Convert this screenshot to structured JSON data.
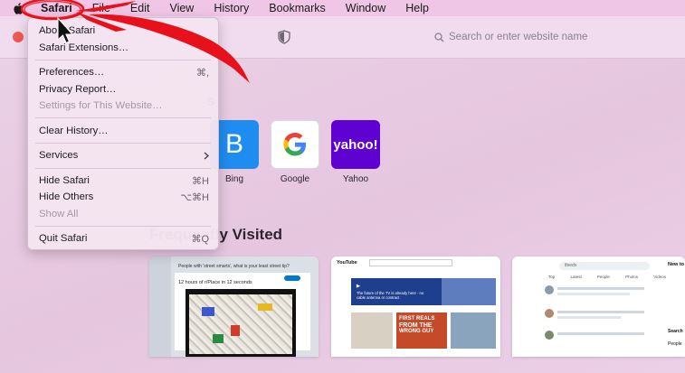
{
  "menubar": {
    "items": [
      "Safari",
      "File",
      "Edit",
      "View",
      "History",
      "Bookmarks",
      "Window",
      "Help"
    ]
  },
  "toolbar": {
    "address_placeholder": "Search or enter website name"
  },
  "favorites": {
    "partial_heading": "s",
    "items": [
      {
        "label": "Bing",
        "glyph": "B",
        "color": "#1f8cf0"
      },
      {
        "label": "Google",
        "glyph": "G",
        "color": "#ffffff"
      },
      {
        "label": "Yahoo",
        "glyph": "yahoo!",
        "color": "#5f01d1"
      }
    ]
  },
  "frequently_visited": {
    "title": "Frequently Visited",
    "thumb1": {
      "header": "People with 'street smarts', what is your least street tip?",
      "subtitle": "12 hours of r/Place in 12 seconds"
    },
    "thumb2": {
      "brand": "YouTube",
      "headline": "The future of the TV is already here - no cable antenna or contract",
      "thumb_text_1": "FIRST REALS",
      "thumb_text_2": "FROM THE",
      "thumb_text_3": "WRONG GUY"
    },
    "thumb3": {
      "search": "ifeeds",
      "tabs": [
        "Top",
        "Latest",
        "People",
        "Photos",
        "Videos"
      ],
      "side_title": "New to",
      "side_label_2": "Search",
      "side_label_3": "People"
    }
  },
  "safari_menu": {
    "about": "About Safari",
    "extensions": "Safari Extensions…",
    "preferences": "Preferences…",
    "preferences_shortcut": "⌘,",
    "privacy": "Privacy Report…",
    "settings_site": "Settings for This Website…",
    "clear_history": "Clear History…",
    "services": "Services",
    "hide_safari": "Hide Safari",
    "hide_safari_shortcut": "⌘H",
    "hide_others": "Hide Others",
    "hide_others_shortcut": "⌥⌘H",
    "show_all": "Show All",
    "quit": "Quit Safari",
    "quit_shortcut": "⌘Q"
  },
  "colors": {
    "annotation": "#e8101a",
    "close_button": "#ee5a55"
  }
}
